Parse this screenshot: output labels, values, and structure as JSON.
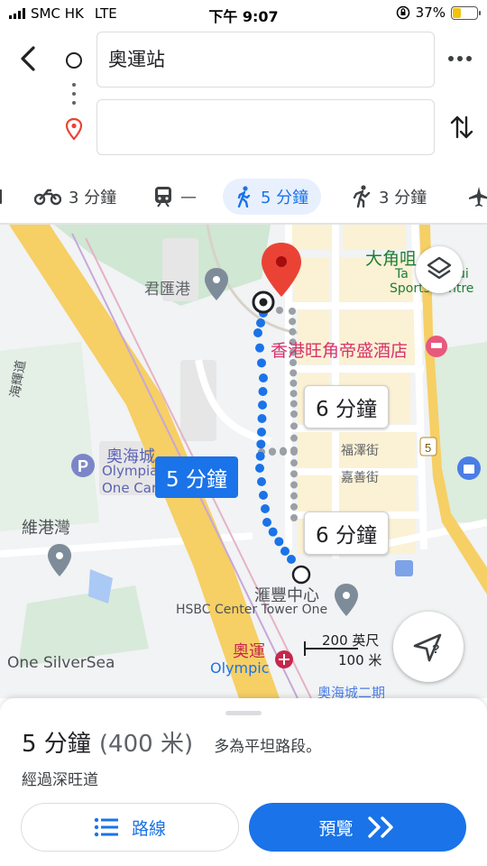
{
  "status_bar": {
    "carrier": "SMC HK",
    "network": "LTE",
    "time": "下午 9:07",
    "battery_percent": "37%",
    "battery_level": 0.37,
    "battery_color": "#f4c20d"
  },
  "search": {
    "origin_value": "奧運站",
    "destination_value": "",
    "icons": {
      "back": "back-arrow-icon",
      "origin": "origin-circle-icon",
      "destination": "destination-pin-icon",
      "more": "more-dots-icon",
      "swap": "swap-icon"
    }
  },
  "modes": [
    {
      "icon": "car-icon",
      "label": ""
    },
    {
      "icon": "motorcycle-icon",
      "label": "3 分鐘"
    },
    {
      "icon": "transit-icon",
      "label": "—"
    },
    {
      "icon": "walk-icon",
      "label": "5 分鐘",
      "active": true
    },
    {
      "icon": "rideshare-icon",
      "label": "3 分鐘"
    },
    {
      "icon": "flight-icon",
      "label": ""
    }
  ],
  "map": {
    "labels": {
      "jun_hui": "君匯港",
      "tai_kok_tsui": "大角咀",
      "sports_centre_1": "Ta",
      "sports_centre_2": "ui",
      "sports_centre_3": "Sports",
      "sports_centre_4": "ntre",
      "hotel": "香港旺角帝盛酒店",
      "olympian_cn": "奧海城",
      "olympian_en": "Olympian",
      "one_car": "One Car",
      "victoria": "維港灣",
      "fuk_chak": "福澤街",
      "ka_shin": "嘉善街",
      "hsbc_cn": "滙豐中心",
      "hsbc_en": "HSBC Center Tower One",
      "olympic_cn": "奧運",
      "olympic_en": "Olympic",
      "one_silversea": "One SilverSea",
      "olympian_2": "奧海城二期",
      "road_5": "5",
      "hai_road": "海輝道"
    },
    "route_chips": {
      "primary": "5 分鐘",
      "alt_1": "6 分鐘",
      "alt_2": "6 分鐘"
    },
    "scale": {
      "imperial": "200 英尺",
      "metric": "100 米"
    },
    "buttons": {
      "layers": "layers-icon",
      "locate": "location-arrow-icon"
    },
    "colors": {
      "route": "#1a73e8",
      "alt_route": "#9aa0a6",
      "highway": "#f6cf65",
      "pin": "#ea4335",
      "block": "#fbf4dc"
    }
  },
  "summary": {
    "duration": "5 分鐘",
    "distance": "(400 米)",
    "note": "多為平坦路段。",
    "via": "經過深旺道"
  },
  "buttons": {
    "route_label": "路線",
    "preview_label": "預覽"
  }
}
